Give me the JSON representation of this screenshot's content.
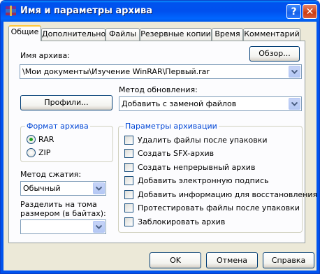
{
  "window": {
    "title": "Имя и параметры архива",
    "help_glyph": "?",
    "close_glyph": "✕"
  },
  "tabs": [
    {
      "label": "Общие",
      "active": true
    },
    {
      "label": "Дополнительно"
    },
    {
      "label": "Файлы"
    },
    {
      "label": "Резервные копии"
    },
    {
      "label": "Время"
    },
    {
      "label": "Комментарий"
    }
  ],
  "archive_name": {
    "label": "Имя архива:",
    "browse_button": "Обзор...",
    "value": "\\Мои документы\\Изучение WinRAR\\Первый.rar"
  },
  "update_method": {
    "label": "Метод обновления:",
    "value": "Добавить с заменой файлов"
  },
  "profiles_button": "Профили...",
  "archive_format": {
    "title": "Формат архива",
    "options": [
      {
        "label": "RAR",
        "selected": true
      },
      {
        "label": "ZIP",
        "selected": false
      }
    ]
  },
  "compression": {
    "label": "Метод сжатия:",
    "value": "Обычный"
  },
  "split": {
    "label_line1": "Разделить на тома",
    "label_line2": "размером (в байтах):",
    "value": ""
  },
  "archive_options": {
    "title": "Параметры архивации",
    "items": [
      {
        "label": "Удалить файлы после упаковки",
        "checked": false
      },
      {
        "label": "Создать SFX-архив",
        "checked": false
      },
      {
        "label": "Создать непрерывный архив",
        "checked": false
      },
      {
        "label": "Добавить электронную подпись",
        "checked": false
      },
      {
        "label": "Добавить информацию для восстановления",
        "checked": false
      },
      {
        "label": "Протестировать файлы после упаковки",
        "checked": false
      },
      {
        "label": "Заблокировать архив",
        "checked": false
      }
    ]
  },
  "footer": {
    "ok": "OK",
    "cancel": "Отмена",
    "help": "Справка"
  },
  "colors": {
    "titlebar": "#0053ee",
    "group_title": "#0046d5",
    "dialog_bg": "#ece9d8",
    "radio_dot": "#21a121"
  }
}
